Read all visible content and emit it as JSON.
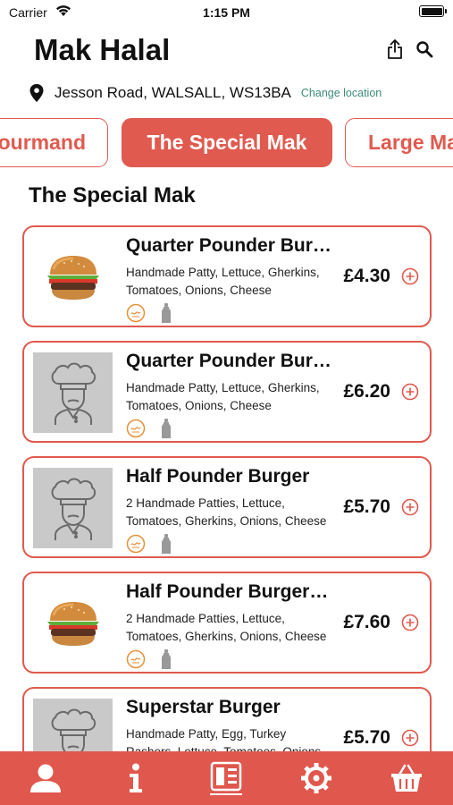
{
  "status_bar": {
    "carrier": "Carrier",
    "time": "1:15 PM",
    "battery_level": 1.0
  },
  "header": {
    "title": "Mak Halal",
    "share_icon": "share-icon",
    "search_icon": "search-icon"
  },
  "location": {
    "address": "Jesson Road, WALSALL, WS13BA",
    "change_label": "Change location",
    "icon": "pin-icon"
  },
  "tabs": [
    {
      "label": "Gourmand",
      "active": false
    },
    {
      "label": "The Special Mak",
      "active": true
    },
    {
      "label": "Large Mak",
      "active": false
    }
  ],
  "section": {
    "title": "The Special Mak"
  },
  "menu_items": [
    {
      "name": "Quarter Pounder Burger",
      "description": "Handmade Patty, Lettuce, Gherkins, Tomatoes, Onions, Cheese",
      "price": "£4.30",
      "image": "burger-photo"
    },
    {
      "name": "Quarter Pounder Burger Meal",
      "description": "Handmade Patty, Lettuce, Gherkins, Tomatoes, Onions, Cheese",
      "price": "£6.20",
      "image": "chef-placeholder"
    },
    {
      "name": "Half Pounder Burger",
      "description": "2 Handmade Patties, Lettuce, Tomatoes, Gherkins, Onions, Cheese",
      "price": "£5.70",
      "image": "chef-placeholder"
    },
    {
      "name": "Half Pounder Burger Meal",
      "description": "2 Handmade Patties, Lettuce, Tomatoes, Gherkins, Onions, Cheese",
      "price": "£7.60",
      "image": "burger-photo"
    },
    {
      "name": "Superstar Burger",
      "description": "Handmade Patty, Egg, Turkey Rashers, Lettuce, Tomatoes, Onions",
      "price": "£5.70",
      "image": "chef-placeholder"
    }
  ],
  "bottom_nav": [
    {
      "icon": "user-icon"
    },
    {
      "icon": "info-icon"
    },
    {
      "icon": "menu-icon",
      "active": true
    },
    {
      "icon": "settings-icon"
    },
    {
      "icon": "basket-icon"
    }
  ],
  "colors": {
    "accent": "#e05a4f",
    "link": "#3d8a7a",
    "placeholder": "#c9c9c9",
    "nav_bg": "#e0574d"
  }
}
